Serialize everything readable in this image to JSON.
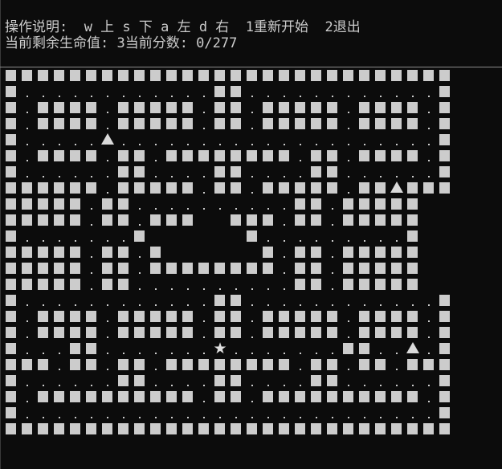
{
  "console": {
    "background": "#0c0c0c",
    "foreground": "#cccccc"
  },
  "hud": {
    "controls_text": "操作说明:  w 上 s 下 a 左 d 右  1重新开始  2退出",
    "status_text": "当前剩余生命值: 3当前分数: 0/277"
  },
  "game": {
    "lives": 3,
    "score": 0,
    "max_score": 277,
    "map_rows": [
      "############################",
      "#............##............#",
      "#.####.#####.##.#####.####.#",
      "#.####.#####.##.#####.####.#",
      "#.....G....................#",
      "#.####.##.########.##.####.#",
      "#......##....##....##......#",
      "######.#####.##.#####.##G###",
      "#####.##..........##.#####",
      "#####.##.###  ###.##.#####",
      "#.......#      #.........#",
      "#####.##.#      #.##.#####",
      "#####.##.########.##.#####",
      "#####.##..........##.#####",
      "#............##............#",
      "#.####.#####.##.#####.####.#",
      "#.####.#####.##.#####.####.#",
      "#...##.......P.......##..G.#",
      "###.##.##.########.##.##.###",
      "#......##....##....##......#",
      "#.##########.##.##########.#",
      "#..........................#",
      "############################"
    ],
    "ghost_icon": "triangle-up-icon",
    "player_icon": "star-icon",
    "wall_icon": "square-block-icon",
    "pellet_icon": "dot-icon",
    "wall_color": "#cccccc",
    "ghost_color": "#dadada"
  }
}
